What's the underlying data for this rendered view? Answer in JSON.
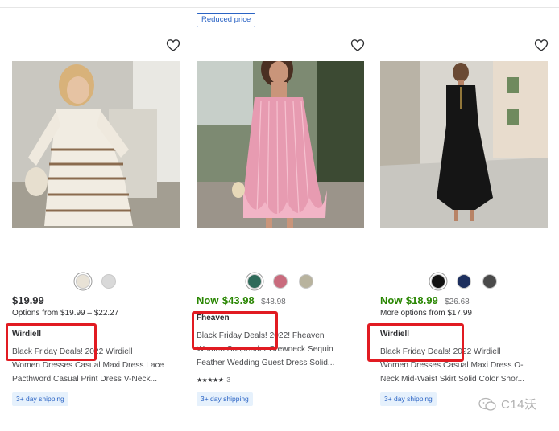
{
  "products": [
    {
      "badge": "",
      "price_now_label": "",
      "price": "$19.99",
      "was_price": "",
      "options": "Options from $19.99 – $22.27",
      "brand": "Wirdiell",
      "title_lines": [
        "Black Friday Deals! 2022 Wirdiell",
        "Women Dresses Casual Maxi Dress Lace",
        "Pacthword Casual Print Dress V-Neck..."
      ],
      "rating_count": "",
      "shipping": "3+ day shipping",
      "swatch_colors": [
        "#e8e2d6",
        "#d9d9d9"
      ],
      "image_desc": "woman in white striped boho dress"
    },
    {
      "badge": "Reduced price",
      "price_now_label": "Now",
      "price": "$43.98",
      "was_price": "$48.98",
      "options": "",
      "brand": "Fheaven",
      "title_lines": [
        "Black Friday Deals! 2022! Fheaven",
        "Women Suspender Crewneck Sequin",
        "Feather Wedding Guest Dress Solid..."
      ],
      "rating_count": "3",
      "shipping": "3+ day shipping",
      "swatch_colors": [
        "#2f6b5a",
        "#c96b7d",
        "#b8b39e"
      ],
      "image_desc": "woman in pink sequin feather dress"
    },
    {
      "badge": "",
      "price_now_label": "Now",
      "price": "$18.99",
      "was_price": "$26.68",
      "options": "More options from $17.99",
      "brand": "Wirdiell",
      "title_lines": [
        "Black Friday Deals! 2022 Wirdiell",
        "Women Dresses Casual Maxi Dress O-",
        "Neck Mid-Waist Skirt Solid Color Shor..."
      ],
      "rating_count": "",
      "shipping": "3+ day shipping",
      "swatch_colors": [
        "#111111",
        "#1d2f5e",
        "#4a4a4a"
      ],
      "image_desc": "woman in black maxi dress on street"
    }
  ],
  "stars": "★★★★★",
  "watermark": "C14沃",
  "colors": {
    "price_green": "#2a8703",
    "link_blue": "#2a63c4",
    "highlight_red": "#e11b22"
  }
}
